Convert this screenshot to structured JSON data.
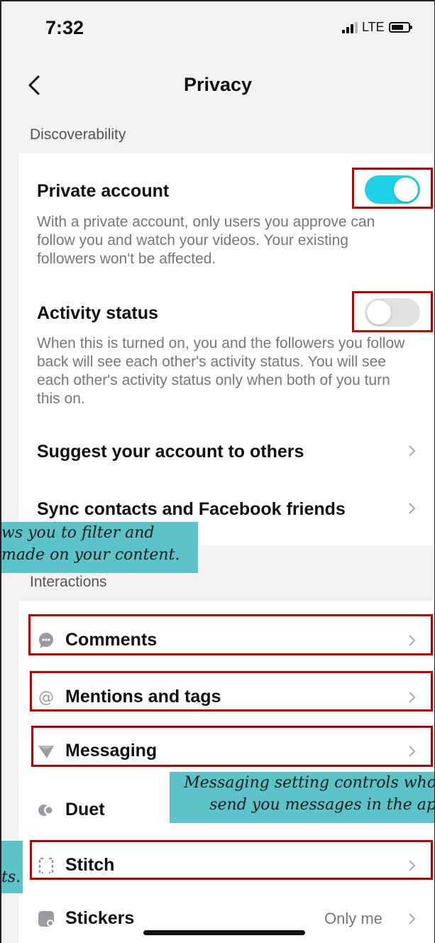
{
  "status_bar": {
    "time": "7:32",
    "network": "LTE"
  },
  "header": {
    "title": "Privacy"
  },
  "discoverability": {
    "section_label": "Discoverability",
    "private_account": {
      "title": "Private account",
      "description": "With a private account, only users you approve can follow you and watch your videos. Your existing followers won't be affected.",
      "enabled": true
    },
    "activity_status": {
      "title": "Activity status",
      "description": "When this is turned on, you and the followers you follow back will see each other's activity status. You will see each other's activity status only when both of you turn this on.",
      "enabled": false
    },
    "suggest_account": {
      "title": "Suggest your account to others"
    },
    "sync_contacts": {
      "title": "Sync contacts and Facebook friends"
    }
  },
  "interactions": {
    "section_label": "Interactions",
    "items": [
      {
        "label": "Comments",
        "icon": "comment-bubble-icon"
      },
      {
        "label": "Mentions and tags",
        "icon": "at-sign-icon"
      },
      {
        "label": "Messaging",
        "icon": "paper-plane-icon"
      },
      {
        "label": "Duet",
        "icon": "duet-icon"
      },
      {
        "label": "Stitch",
        "icon": "stitch-icon"
      },
      {
        "label": "Stickers",
        "icon": "sticker-icon",
        "value": "Only me"
      }
    ]
  },
  "callouts": {
    "comments_line1": "ws you to filter and",
    "comments_line2": "made on your content.",
    "messaging_line1": "Messaging setting controls who",
    "messaging_line2": "send you messages in the ap",
    "stitch_line1": "ts."
  },
  "colors": {
    "toggle_on": "#1fd1e8",
    "highlight": "#c00000",
    "callout_bg": "#5bc3c9"
  }
}
